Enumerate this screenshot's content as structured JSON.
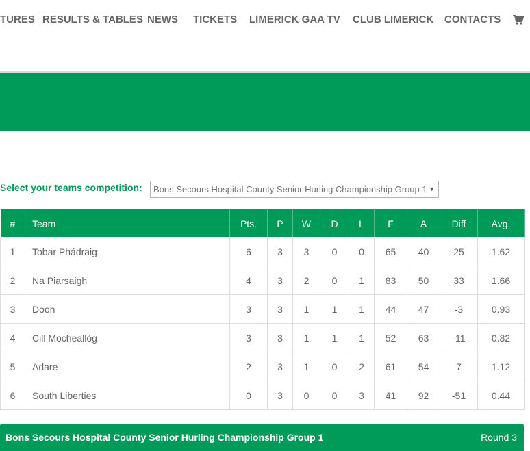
{
  "nav": {
    "items": [
      "TURES",
      "RESULTS & TABLES",
      "NEWS",
      "TICKETS",
      "LIMERICK GAA TV",
      "CLUB LIMERICK",
      "CONTACTS"
    ],
    "cart_icon": "shopping-cart-icon"
  },
  "competition": {
    "label": "Select your teams competition:",
    "selected": "Bons Secours Hospital County Senior Hurling Championship Group 1"
  },
  "colors": {
    "accent": "#009b58"
  },
  "table": {
    "headers": [
      "#",
      "Team",
      "Pts.",
      "P",
      "W",
      "D",
      "L",
      "F",
      "A",
      "Diff",
      "Avg."
    ],
    "rows": [
      [
        "1",
        "Tobar Phádraig",
        "6",
        "3",
        "3",
        "0",
        "0",
        "65",
        "40",
        "25",
        "1.62"
      ],
      [
        "2",
        "Na Piarsaigh",
        "4",
        "3",
        "2",
        "0",
        "1",
        "83",
        "50",
        "33",
        "1.66"
      ],
      [
        "3",
        "Doon",
        "3",
        "3",
        "1",
        "1",
        "1",
        "44",
        "47",
        "-3",
        "0.93"
      ],
      [
        "4",
        "Cill Mocheallòg",
        "3",
        "3",
        "1",
        "1",
        "1",
        "52",
        "63",
        "-11",
        "0.82"
      ],
      [
        "5",
        "Adare",
        "2",
        "3",
        "1",
        "0",
        "2",
        "61",
        "54",
        "7",
        "1.12"
      ],
      [
        "6",
        "South Liberties",
        "0",
        "3",
        "0",
        "0",
        "3",
        "41",
        "92",
        "-51",
        "0.44"
      ]
    ]
  },
  "fixtures": {
    "title": "Bons Secours Hospital County Senior Hurling Championship Group 1",
    "round": "Round 3"
  }
}
